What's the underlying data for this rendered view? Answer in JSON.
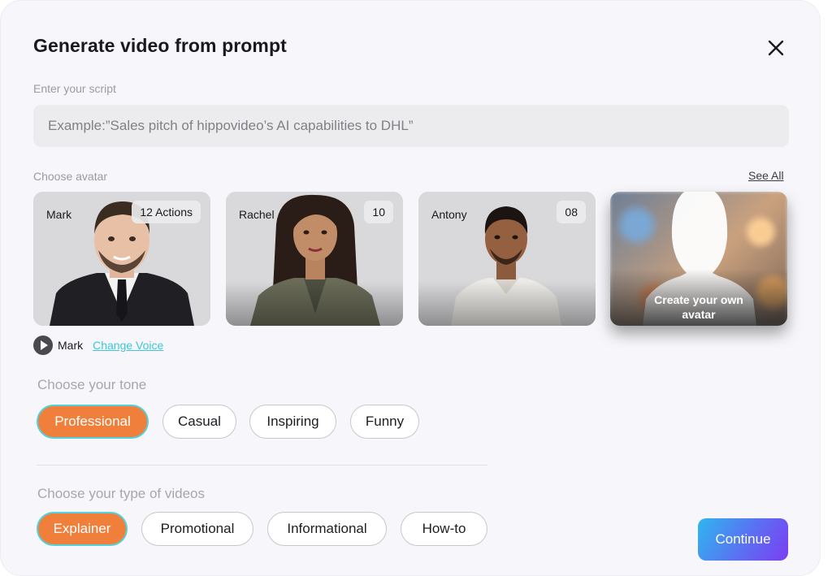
{
  "title": "Generate video from prompt",
  "script": {
    "label": "Enter your script",
    "placeholder": "Example:”Sales pitch of hippovideo’s AI capabilities to DHL”"
  },
  "avatar": {
    "label": "Choose avatar",
    "see_all": "See All",
    "cards": [
      {
        "name": "Mark",
        "badge": "12 Actions"
      },
      {
        "name": "Rachel",
        "badge": "10"
      },
      {
        "name": "Antony",
        "badge": "08"
      }
    ],
    "create_own": "Create your own avatar"
  },
  "voice": {
    "name": "Mark",
    "change": "Change Voice"
  },
  "tone": {
    "label": "Choose your tone",
    "options": [
      "Professional",
      "Casual",
      "Inspiring",
      "Funny"
    ],
    "selected": "Professional"
  },
  "video_type": {
    "label": "Choose your type of videos",
    "options": [
      "Explainer",
      "Promotional",
      "Informational",
      "How-to"
    ],
    "selected": "Explainer"
  },
  "continue_label": "Continue",
  "colors": {
    "accent_orange": "#f07f3c",
    "selected_border": "#53d0da",
    "link": "#3ec7d8",
    "continue_gradient_start": "#2fb6f0",
    "continue_gradient_end": "#7b3ef2"
  }
}
